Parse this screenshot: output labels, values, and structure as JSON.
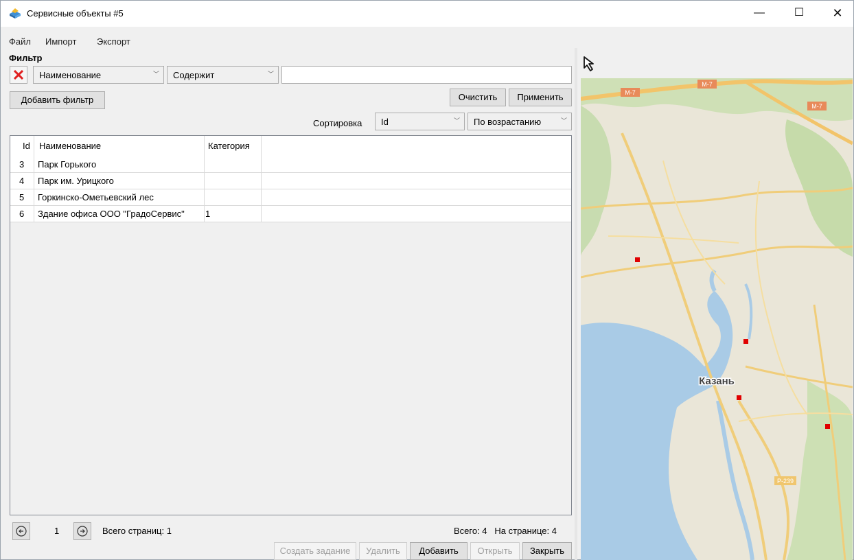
{
  "window": {
    "title": "Сервисные объекты #5",
    "controls": {
      "minimize": "—",
      "maximize": "☐",
      "close": "✕"
    }
  },
  "menu": [
    "Файл",
    "Импорт",
    "Экспорт"
  ],
  "filter": {
    "label": "Фильтр",
    "field": "Наименование",
    "operator": "Содержит",
    "value": "",
    "add_label": "Добавить фильтр",
    "clear_label": "Очистить",
    "apply_label": "Применить"
  },
  "sort": {
    "label": "Сортировка",
    "field": "Id",
    "order": "По возрастанию"
  },
  "table": {
    "columns": [
      "Id",
      "Наименование",
      "Категория"
    ],
    "rows": [
      {
        "id": "3",
        "name": "Парк Горького",
        "category": ""
      },
      {
        "id": "4",
        "name": "Парк им. Урицкого",
        "category": ""
      },
      {
        "id": "5",
        "name": "Горкинско-Ометьевский лес",
        "category": ""
      },
      {
        "id": "6",
        "name": "Здание офиса ООО \"ГрадоСервис\"",
        "category": "1"
      }
    ]
  },
  "pager": {
    "current": "1",
    "total_pages": "Всего страниц: 1",
    "total": "Всего: 4",
    "per_page": "На странице: 4"
  },
  "actions": {
    "create_task": "Создать задание",
    "delete": "Удалить",
    "add": "Добавить",
    "open": "Открыть",
    "close": "Закрыть"
  },
  "map": {
    "city_label": "Казань",
    "road_labels": [
      "М-7",
      "М-7",
      "М-7",
      "Р-239"
    ],
    "marker_color": "#e00000"
  }
}
